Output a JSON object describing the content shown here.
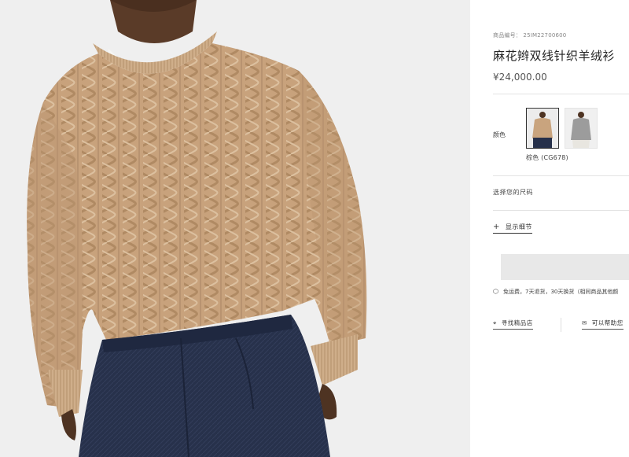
{
  "product": {
    "code": "商品编号： 25IM22700600",
    "name": "麻花辫双线针织羊绒衫",
    "price": "¥24,000.00"
  },
  "color": {
    "label": "颜色",
    "selected_name": "棕色 (CG678)",
    "swatches": [
      {
        "name": "beige",
        "selected": true
      },
      {
        "name": "grey",
        "selected": false
      }
    ]
  },
  "size": {
    "label": "选择您的尺码"
  },
  "details": {
    "label": "显示细节"
  },
  "shipping": {
    "text": "免运费，7天退货，30天换货（相同商品其他颜"
  },
  "links": {
    "store": "寻找精品店",
    "help": "可以帮助您"
  },
  "colors": {
    "sweater": "#c9a47e",
    "pants": "#26304a",
    "background": "#efefef"
  }
}
